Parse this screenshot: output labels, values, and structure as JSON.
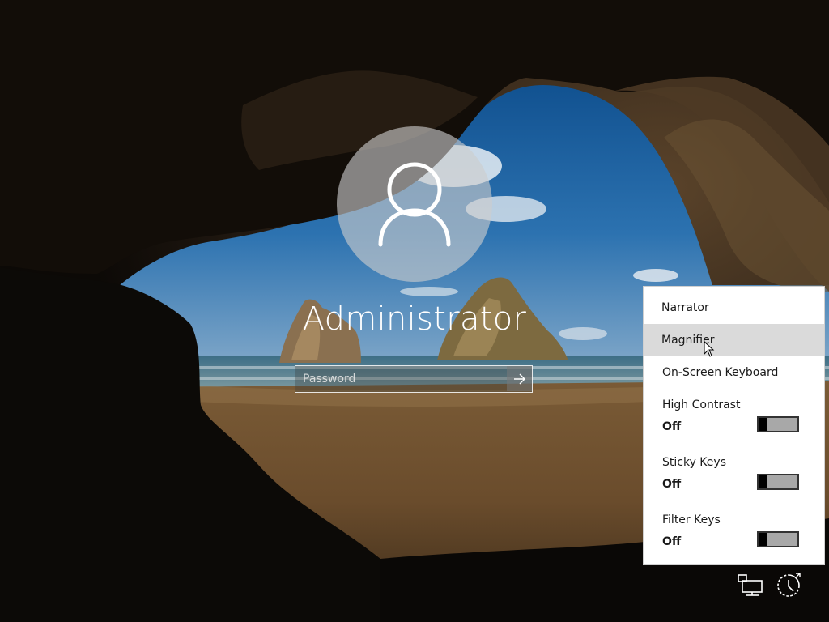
{
  "user": {
    "name": "Administrator"
  },
  "login": {
    "password_placeholder": "Password",
    "password_value": ""
  },
  "ease_of_access": {
    "menu_items": [
      {
        "label": "Narrator"
      },
      {
        "label": "Magnifier",
        "hovered": true
      },
      {
        "label": "On-Screen Keyboard"
      }
    ],
    "toggles": [
      {
        "label": "High Contrast",
        "state": "Off"
      },
      {
        "label": "Sticky Keys",
        "state": "Off"
      },
      {
        "label": "Filter Keys",
        "state": "Off"
      }
    ]
  },
  "system_tray": {
    "icons": [
      "network-icon",
      "ease-of-access-icon"
    ]
  },
  "colors": {
    "menu_background": "#ffffff",
    "menu_hover": "#dadada",
    "toggle_track": "#a8a8a8",
    "toggle_knob": "#000000",
    "text_light": "#ffffff"
  }
}
